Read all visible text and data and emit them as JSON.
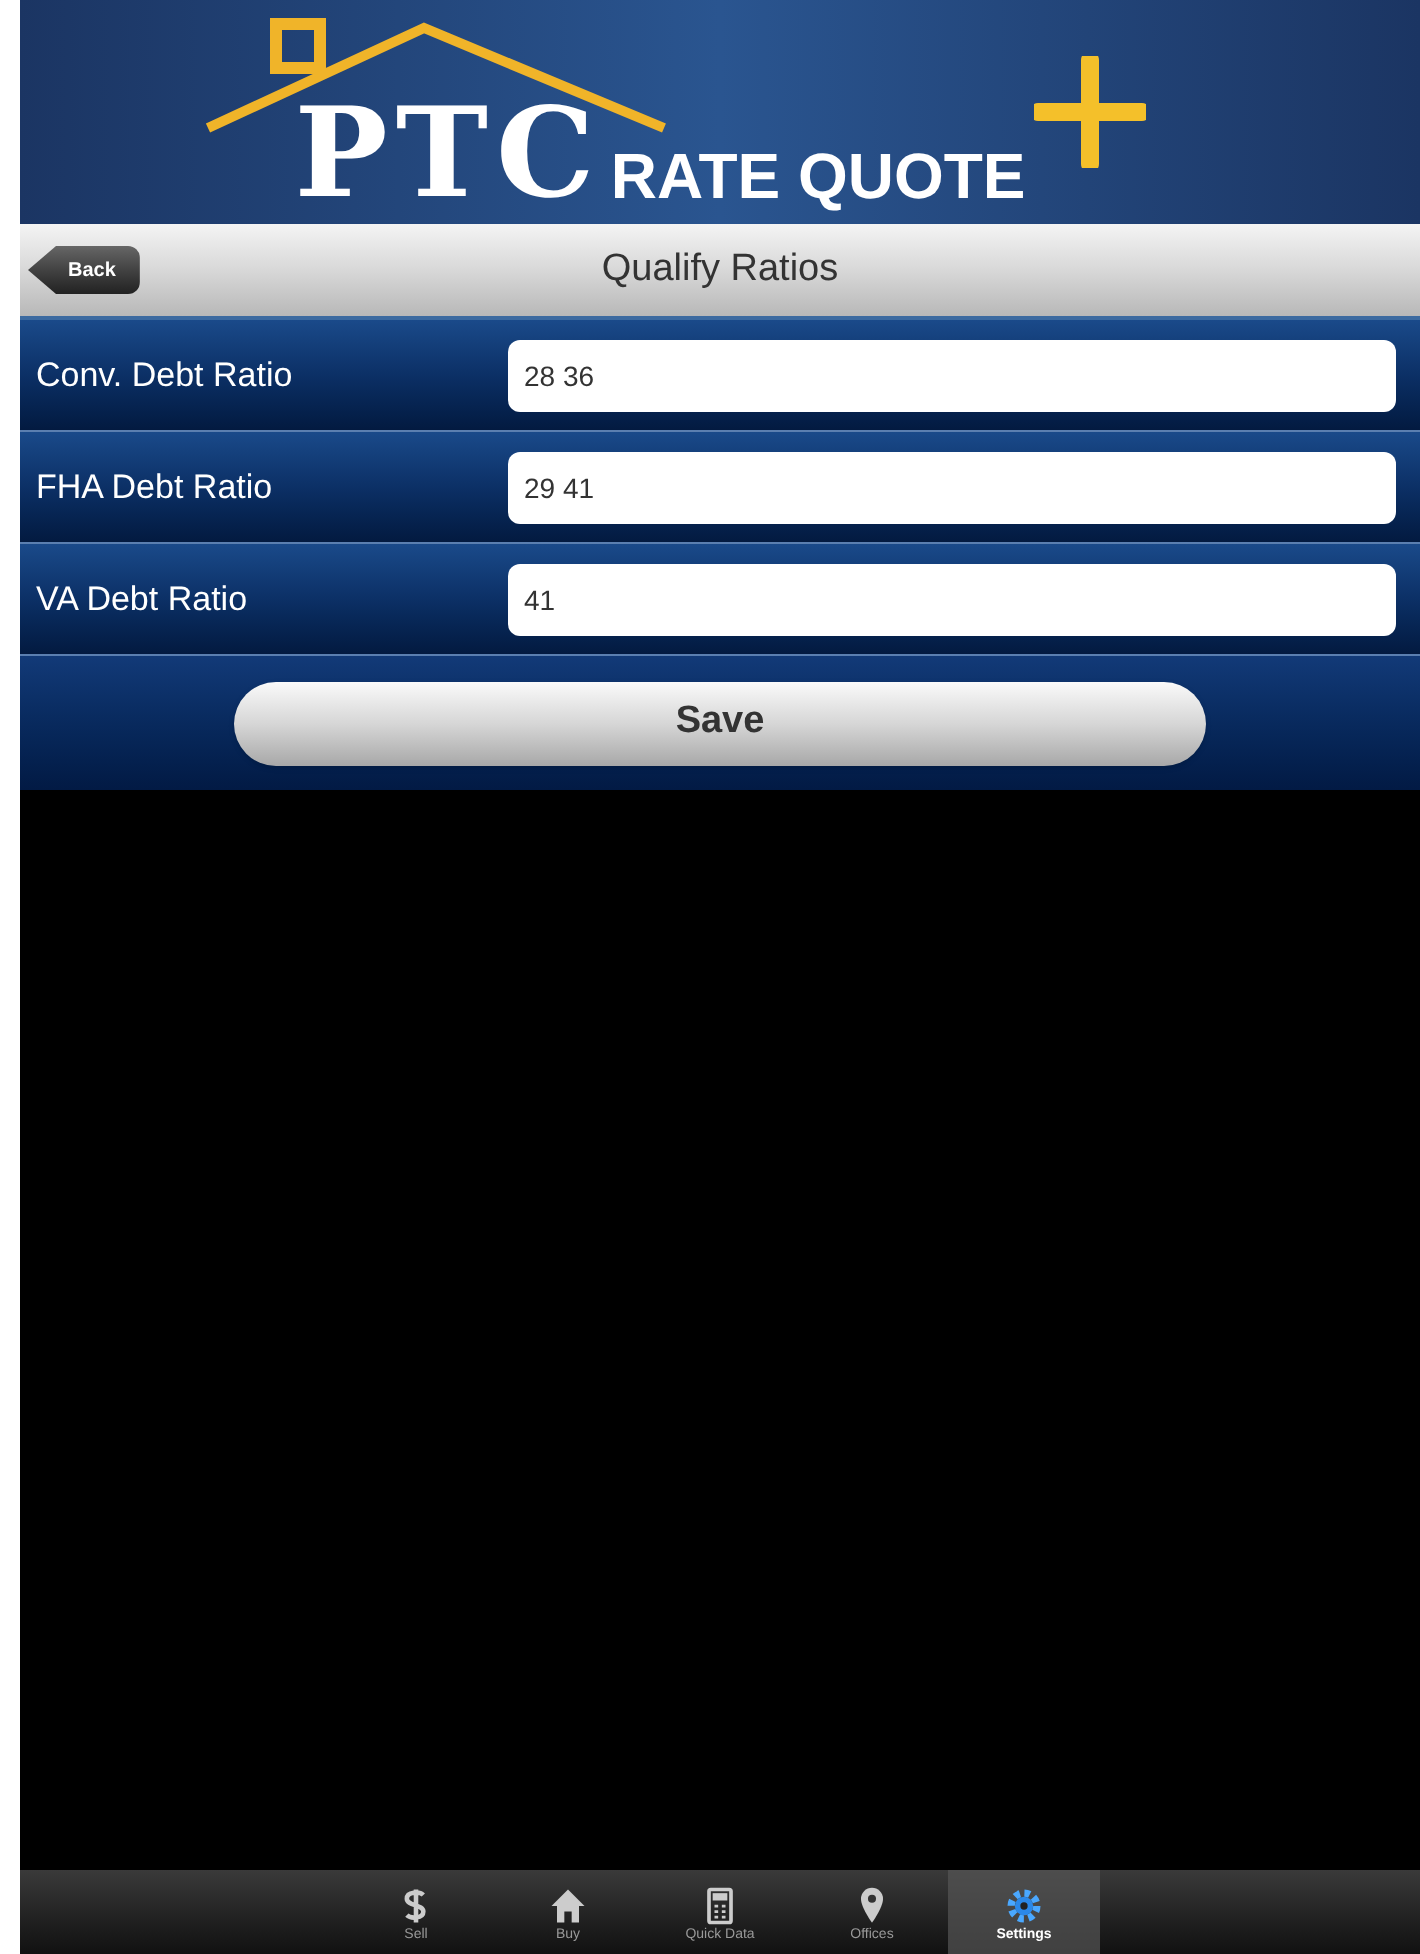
{
  "header": {
    "logo_letters": "PTC",
    "logo_text": "RATE QUOTE"
  },
  "nav_bar": {
    "back": "Back",
    "title": "Qualify Ratios"
  },
  "fields": [
    {
      "label": "Conv. Debt Ratio",
      "value": "28 36"
    },
    {
      "label": "FHA Debt Ratio",
      "value": "29 41"
    },
    {
      "label": "VA Debt Ratio",
      "value": "41"
    }
  ],
  "save_button": "Save",
  "tab_bar": [
    {
      "kind": "dollar",
      "label": "Sell",
      "selected": false
    },
    {
      "kind": "home",
      "label": "Buy",
      "selected": false
    },
    {
      "kind": "calculator",
      "label": "Quick Data",
      "selected": false
    },
    {
      "kind": "pin",
      "label": "Offices",
      "selected": false
    },
    {
      "kind": "gear",
      "label": "Settings",
      "selected": true
    }
  ]
}
